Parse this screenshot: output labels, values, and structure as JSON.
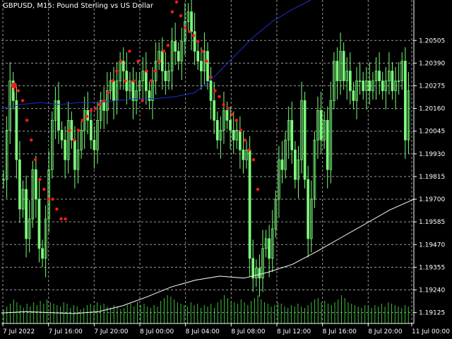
{
  "window": {
    "title": "GBPUSD, M15:  Pound Sterling vs US Dollar"
  },
  "colors": {
    "background": "#000000",
    "grid": "#9a9a9a",
    "axis": "#ffffff",
    "candle": "#7CFC7C",
    "volume": "#3fbf3f",
    "ma_fast": "#1e2fd0",
    "ma_slow": "#ffffff",
    "sar": "#ff1a1a"
  },
  "chart_data": {
    "type": "line",
    "symbol": "GBPUSD",
    "timeframe": "M15",
    "y_ticks": [
      "1.20505",
      "1.20390",
      "1.20275",
      "1.20160",
      "1.20045",
      "1.19930",
      "1.19815",
      "1.19700",
      "1.19585",
      "1.19470",
      "1.19355",
      "1.19240",
      "1.19125"
    ],
    "x_ticks": [
      "7 Jul 2022",
      "7 Jul 16:00",
      "7 Jul 20:00",
      "8 Jul 00:00",
      "8 Jul 04:00",
      "8 Jul 08:00",
      "8 Jul 12:00",
      "8 Jul 16:00",
      "8 Jul 20:00",
      "11 Jul 00:00"
    ],
    "ylim": [
      1.1907,
      1.2071
    ],
    "series": [
      {
        "kind": "candles",
        "close": [
          1.198,
          1.2005,
          1.203,
          1.202,
          1.199,
          1.1965,
          1.1975,
          1.195,
          1.196,
          1.1985,
          1.197,
          1.1945,
          1.194,
          1.196,
          1.1985,
          1.201,
          1.202,
          1.2005,
          1.2,
          1.199,
          1.201,
          1.2,
          1.1985,
          1.1995,
          1.2005,
          1.2015,
          1.201,
          1.2,
          1.1995,
          1.201,
          1.202,
          1.2015,
          1.2025,
          1.203,
          1.202,
          1.203,
          1.204,
          1.2035,
          1.2025,
          1.203,
          1.202,
          1.2025,
          1.203,
          1.2035,
          1.2025,
          1.202,
          1.203,
          1.204,
          1.2045,
          1.2035,
          1.203,
          1.2035,
          1.205,
          1.2045,
          1.204,
          1.205,
          1.206,
          1.2065,
          1.2055,
          1.2045,
          1.204,
          1.2035,
          1.2045,
          1.203,
          1.202,
          1.201,
          1.2,
          1.2005,
          1.2015,
          1.201,
          1.2005,
          1.2,
          1.2005,
          1.1995,
          1.199,
          1.1995,
          1.194,
          1.193,
          1.1935,
          1.193,
          1.1945,
          1.195,
          1.194,
          1.1955,
          1.197,
          1.199,
          1.1985,
          1.2,
          1.201,
          1.1995,
          1.198,
          1.199,
          1.202,
          1.198,
          1.195,
          1.197,
          1.2,
          1.2015,
          1.2,
          1.201,
          1.1985,
          1.202,
          1.204,
          1.203,
          1.2045,
          1.203,
          1.2035,
          1.2025,
          1.202,
          1.203,
          1.203,
          1.2025,
          1.203,
          1.2025,
          1.203,
          1.2035,
          1.203,
          1.2025,
          1.203,
          1.2035,
          1.2025,
          1.203,
          1.203,
          1.204,
          1.2,
          1.2025
        ]
      },
      {
        "kind": "ma",
        "name": "",
        "values": [
          1.2016,
          1.2018,
          1.2019,
          1.2018,
          1.2019,
          1.2019,
          1.202,
          1.2021,
          1.2021,
          1.2022,
          1.2024,
          1.2032,
          1.2042,
          1.2052,
          1.206,
          1.2066,
          1.2071
        ]
      },
      {
        "kind": "ma",
        "name": "",
        "values": [
          1.19123,
          1.1913,
          1.19125,
          1.1912,
          1.1913,
          1.1916,
          1.19205,
          1.19255,
          1.1929,
          1.1931,
          1.193,
          1.1933,
          1.1937,
          1.19435,
          1.19505,
          1.19575,
          1.19645,
          1.197
        ]
      },
      {
        "kind": "sar",
        "name": "",
        "values": [
          1.2027,
          1.2025,
          1.202,
          1.201,
          1.2,
          1.199,
          1.198,
          1.1975,
          1.197,
          1.197,
          1.1965,
          1.196,
          1.196,
          1.2005,
          1.2,
          1.2005,
          1.201,
          1.2012,
          1.2015,
          1.2016,
          1.2018,
          1.202,
          1.2024,
          1.203,
          1.2035,
          1.204,
          1.203,
          1.2045,
          1.203,
          1.204,
          1.202,
          1.2035,
          1.203,
          1.2035,
          1.204,
          1.2045,
          1.2048,
          1.2065,
          1.207,
          1.2063,
          1.2057,
          1.2055,
          1.2053,
          1.205,
          1.2045,
          1.204,
          1.2032,
          1.2025,
          1.2022,
          1.2018,
          1.2016,
          1.2013,
          1.201,
          1.2005,
          1.2,
          1.1995,
          1.199,
          1.1975
        ]
      }
    ],
    "volume": [
      20,
      24,
      28,
      34,
      30,
      26,
      22,
      28,
      24,
      30,
      26,
      32,
      28,
      34,
      30,
      28,
      26,
      24,
      30,
      28,
      22,
      26,
      24,
      20,
      22,
      26,
      28,
      24,
      30,
      26,
      28,
      24,
      22,
      26,
      24,
      20,
      22,
      26,
      28,
      24,
      30,
      26,
      28,
      24,
      22,
      26,
      24,
      32,
      36,
      40,
      38,
      34,
      30,
      28,
      26,
      24,
      30,
      26,
      28,
      22,
      26,
      24,
      28,
      22,
      30,
      34,
      40,
      36,
      32,
      30,
      28,
      34,
      30,
      26,
      32,
      36,
      40,
      34,
      30,
      28,
      24,
      26,
      30,
      28,
      24,
      22,
      26,
      24,
      28,
      24,
      22,
      26,
      30,
      34,
      36,
      30,
      32,
      28,
      26,
      30,
      34,
      40,
      36,
      30,
      28,
      26,
      24,
      22,
      26,
      24,
      22,
      26,
      24,
      28,
      24,
      30,
      28,
      26,
      24,
      22,
      26,
      24
    ]
  }
}
